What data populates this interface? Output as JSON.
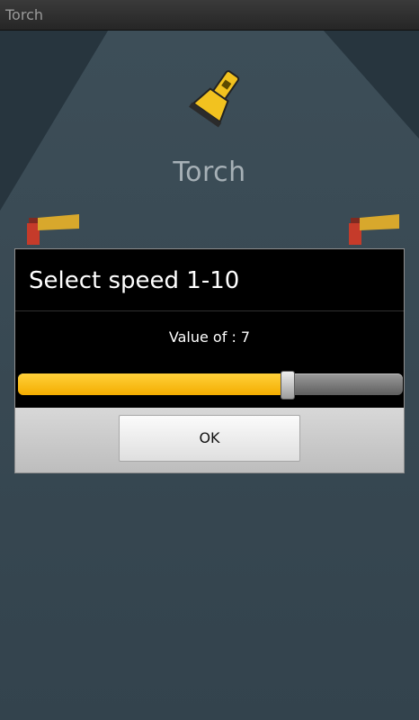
{
  "window": {
    "title": "Torch"
  },
  "background": {
    "title": "Torch"
  },
  "dialog": {
    "title": "Select speed 1-10",
    "value_text": "Value of : 7",
    "slider": {
      "min": 1,
      "max": 10,
      "value": 7,
      "fill_fraction": 0.7
    },
    "ok_label": "OK"
  },
  "colors": {
    "accent": "#f7c21a",
    "dialog_bg": "#000000",
    "page_bg": "#2c3b45"
  },
  "icons": {
    "app_logo": "flashlight-icon",
    "left_decoration": "flashlight-icon",
    "right_decoration": "flashlight-icon"
  }
}
